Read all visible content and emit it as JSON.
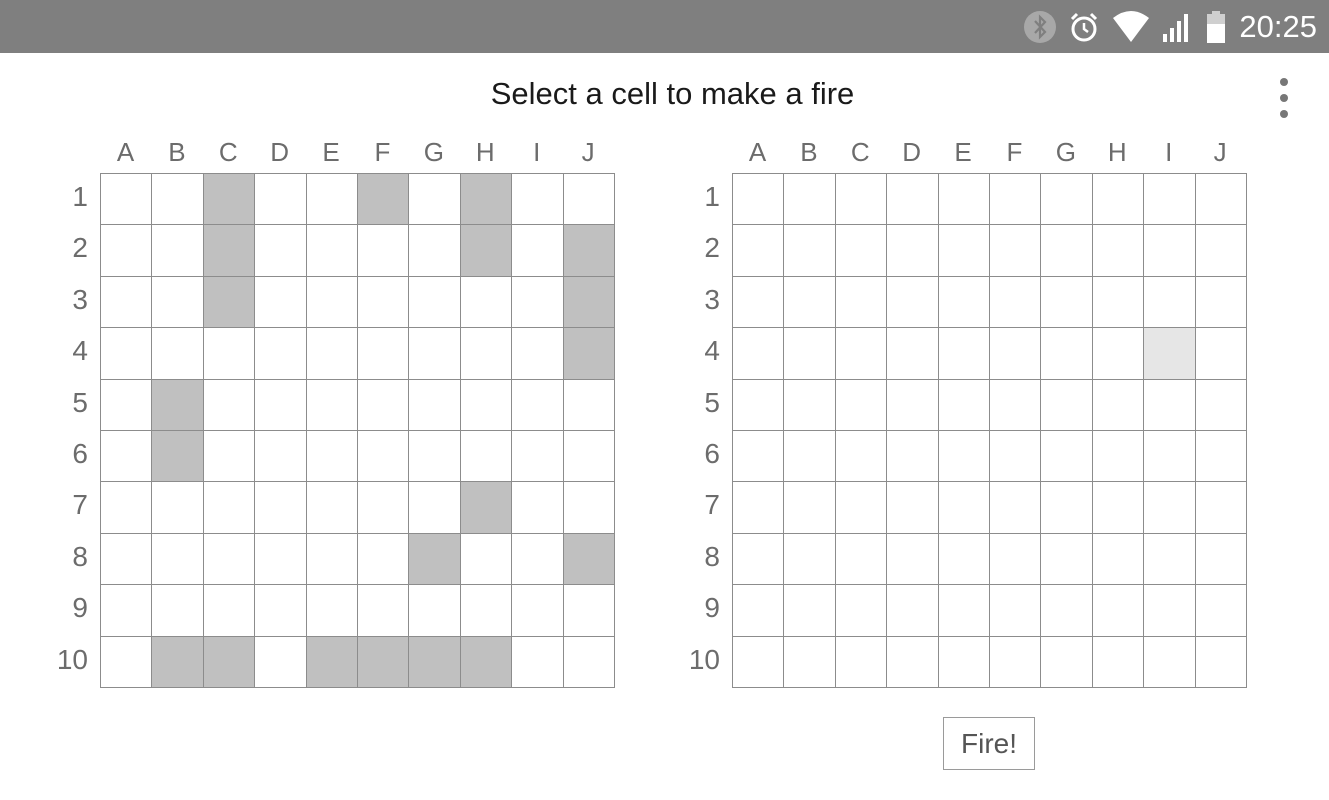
{
  "status_bar": {
    "time": "20:25",
    "icons": [
      "bluetooth-icon",
      "alarm-icon",
      "wifi-icon",
      "signal-icon",
      "battery-icon"
    ],
    "background": "#7f7f7f"
  },
  "header": {
    "title": "Select a cell to make a fire",
    "menu_icon": "overflow-menu-icon"
  },
  "boards": {
    "columns": [
      "A",
      "B",
      "C",
      "D",
      "E",
      "F",
      "G",
      "H",
      "I",
      "J"
    ],
    "rows": [
      "1",
      "2",
      "3",
      "4",
      "5",
      "6",
      "7",
      "8",
      "9",
      "10"
    ],
    "player": {
      "ship_cells": [
        "C1",
        "F1",
        "H1",
        "C2",
        "H2",
        "J2",
        "C3",
        "J3",
        "J4",
        "B5",
        "B6",
        "H7",
        "G8",
        "J8",
        "B10",
        "C10",
        "E10",
        "F10",
        "G10",
        "H10"
      ]
    },
    "opponent": {
      "selected_cells": [
        "I4"
      ]
    }
  },
  "actions": {
    "fire_label": "Fire!"
  },
  "colors": {
    "ship": "#c0c0c0",
    "selected": "#e6e6e6",
    "grid_line": "#8c8c8c"
  }
}
